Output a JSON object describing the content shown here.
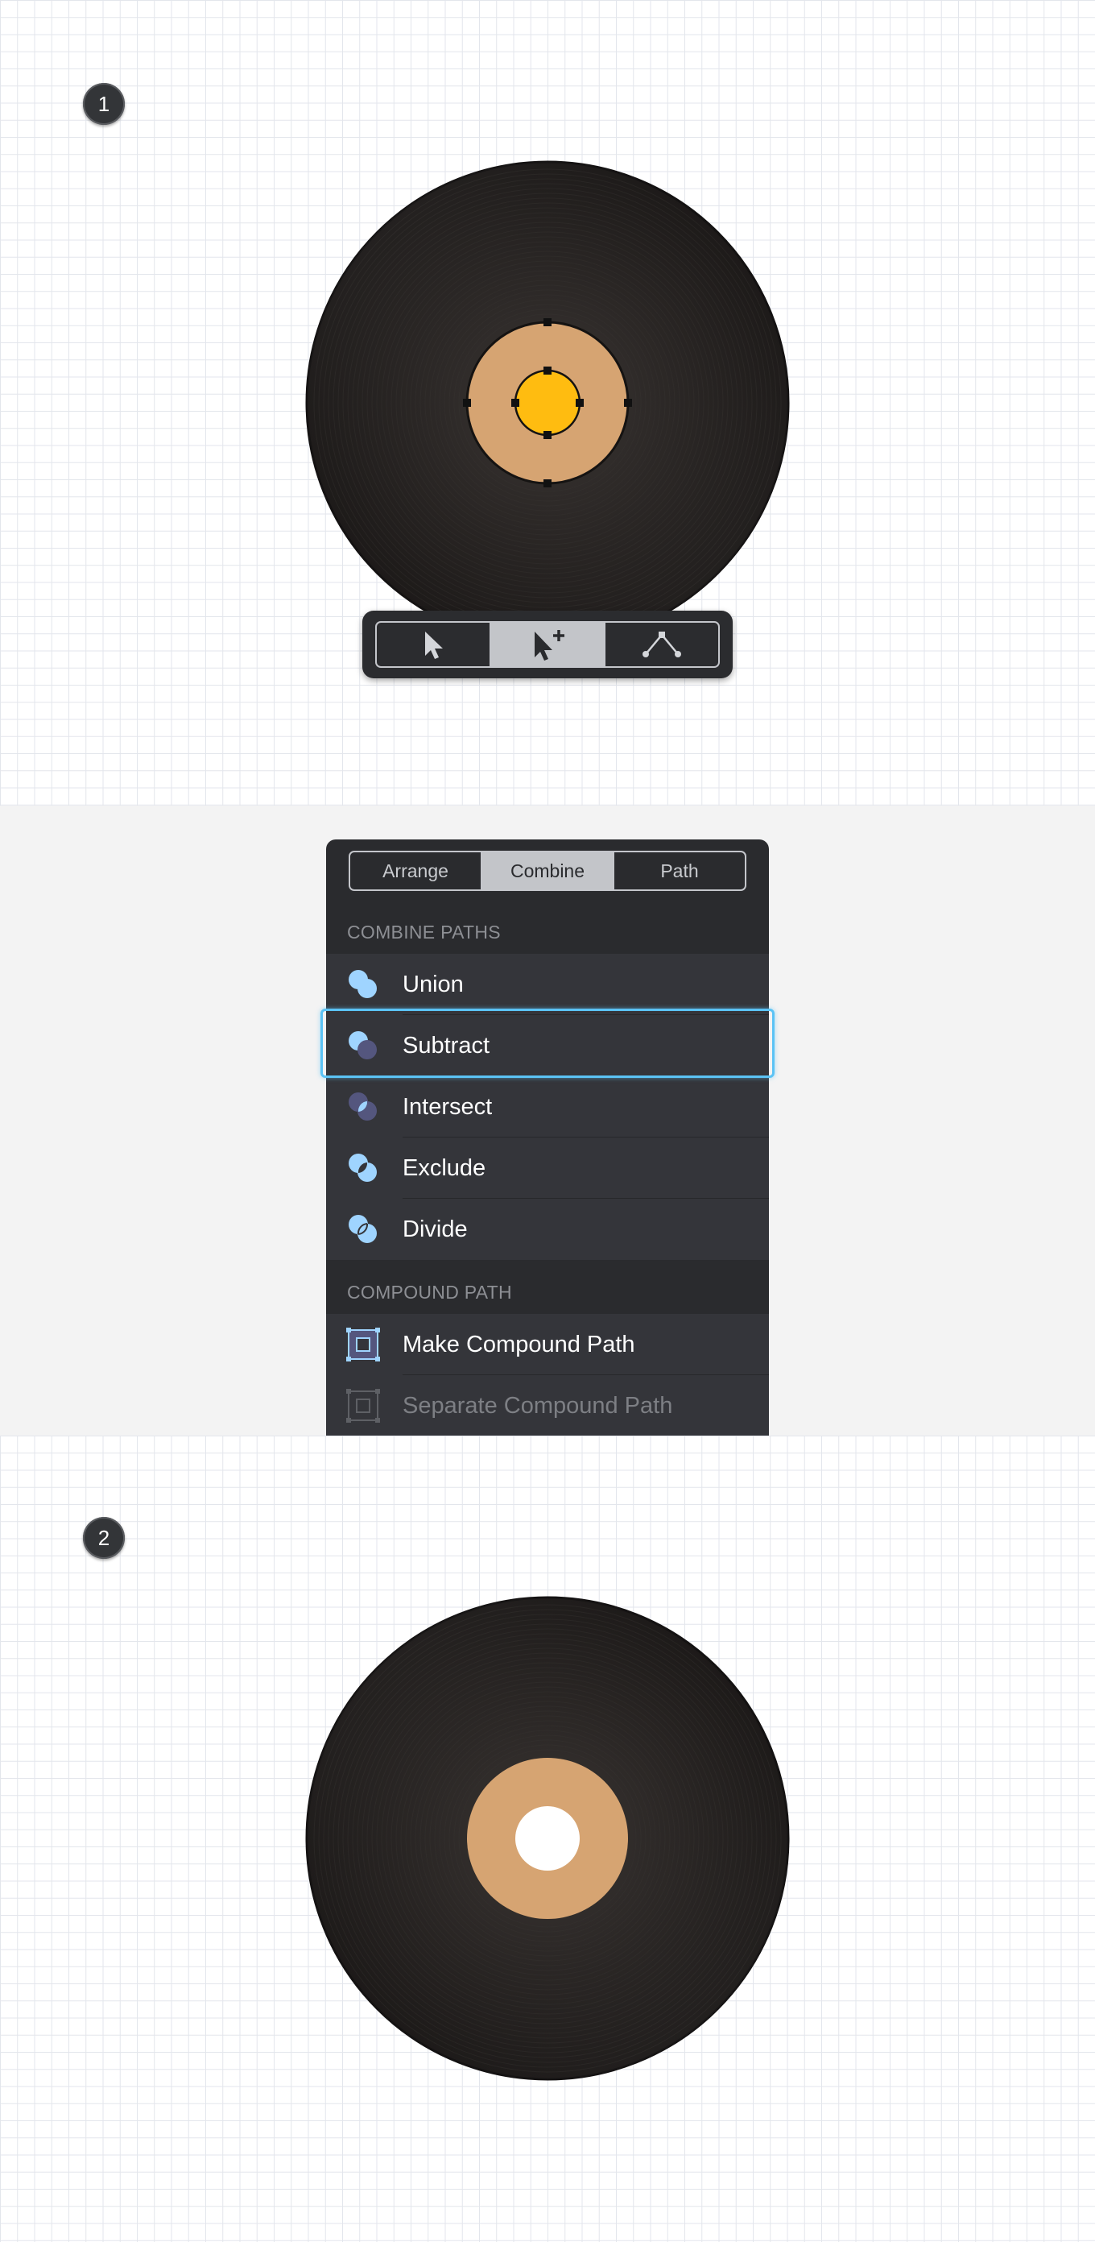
{
  "steps": {
    "step1": "1",
    "step2": "2"
  },
  "record": {
    "disc_color": "#1f1c1b",
    "groove_color": "#3a3634",
    "label_color": "#d6a472",
    "center_selected_color": "#ffbc10",
    "hole_color": "#ffffff"
  },
  "toolbar": {
    "tools": [
      {
        "icon": "select-arrow-icon",
        "active": false
      },
      {
        "icon": "direct-select-plus-icon",
        "active": true
      },
      {
        "icon": "node-path-icon",
        "active": false
      }
    ]
  },
  "panel": {
    "tabs": [
      {
        "label": "Arrange",
        "active": false
      },
      {
        "label": "Combine",
        "active": true
      },
      {
        "label": "Path",
        "active": false
      }
    ],
    "combine_header": "COMBINE PATHS",
    "combine_items": [
      {
        "label": "Union",
        "icon": "union-icon",
        "selected": false
      },
      {
        "label": "Subtract",
        "icon": "subtract-icon",
        "selected": true
      },
      {
        "label": "Intersect",
        "icon": "intersect-icon",
        "selected": false
      },
      {
        "label": "Exclude",
        "icon": "exclude-icon",
        "selected": false
      },
      {
        "label": "Divide",
        "icon": "divide-icon",
        "selected": false
      }
    ],
    "compound_header": "COMPOUND PATH",
    "compound_items": [
      {
        "label": "Make Compound Path",
        "icon": "make-compound-path-icon",
        "enabled": true
      },
      {
        "label": "Separate Compound Path",
        "icon": "separate-compound-path-icon",
        "enabled": false
      }
    ]
  },
  "colors": {
    "accent": "#5bc3f5",
    "panel_bg": "#2a2b2e",
    "row_bg": "#34353a"
  }
}
